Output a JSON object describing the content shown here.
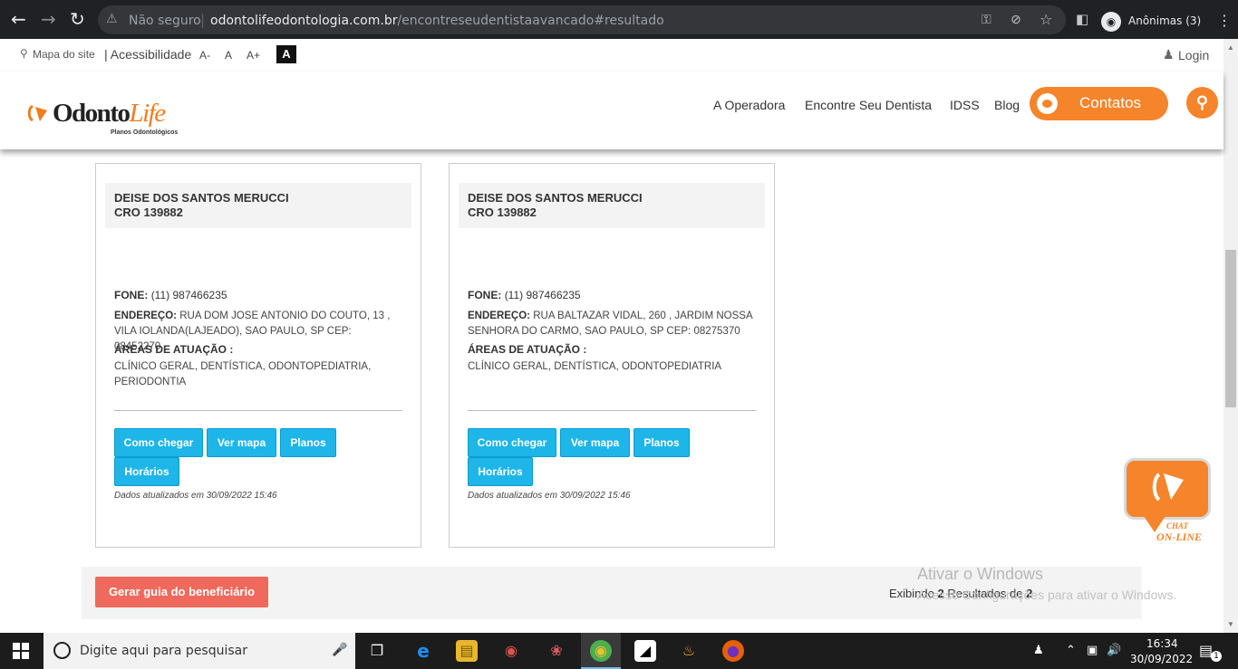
{
  "browser": {
    "security_label": "Não seguro",
    "url_domain": "odontolifeodontologia.com.br",
    "url_path": "/encontreseudentistaavancado#resultado",
    "profile_label": "Anônimas (3)"
  },
  "topbar": {
    "sitemap": "Mapa do site",
    "accessibility": "| Acessibilidade",
    "font_decrease": "A-",
    "font_normal": "A",
    "font_increase": "A+",
    "contrast": "A",
    "login": "Login"
  },
  "header": {
    "logo_word_1": "Odonto",
    "logo_word_2": "Life",
    "logo_sub": "Planos Odontológicos",
    "nav": [
      "A Operadora",
      "Encontre Seu Dentista",
      "IDSS",
      "Blog"
    ],
    "contatos": "Contatos"
  },
  "results": [
    {
      "name": "DEISE DOS SANTOS MERUCCI",
      "cro": "CRO 139882",
      "phone_label": "FONE:",
      "phone": "(11) 987466235",
      "address_label": "ENDEREÇO:",
      "address": "RUA DOM JOSE ANTONIO DO COUTO, 13 , VILA IOLANDA(LAJEADO), SAO PAULO, SP CEP: 08452270",
      "areas_label": "ÁREAS DE ATUAÇÃO :",
      "areas": "CLÍNICO GERAL, DENTÍSTICA, ODONTOPEDIATRIA, PERIODONTIA",
      "buttons": [
        "Como chegar",
        "Ver mapa",
        "Planos",
        "Horários"
      ],
      "updated": "Dados atualizados em 30/09/2022 15:46"
    },
    {
      "name": "DEISE DOS SANTOS MERUCCI",
      "cro": "CRO 139882",
      "phone_label": "FONE:",
      "phone": "(11) 987466235",
      "address_label": "ENDEREÇO:",
      "address": "RUA BALTAZAR VIDAL, 260 , JARDIM NOSSA SENHORA DO CARMO, SAO PAULO, SP CEP: 08275370",
      "areas_label": "ÁREAS DE ATUAÇÃO :",
      "areas": "CLÍNICO GERAL, DENTÍSTICA, ODONTOPEDIATRIA",
      "buttons": [
        "Como chegar",
        "Ver mapa",
        "Planos",
        "Horários"
      ],
      "updated": "Dados atualizados em 30/09/2022 15:46"
    }
  ],
  "footer": {
    "guia_button": "Gerar guia do beneficiário",
    "count_prefix": "Exibindo ",
    "count_shown": "2",
    "count_middle": " Resultados de ",
    "count_total": "2"
  },
  "chat": {
    "line1": "CHAT",
    "line2": "ON-LINE"
  },
  "windows_watermark": {
    "title": "Ativar o Windows",
    "subtitle": "Acesse Configurações para ativar o Windows."
  },
  "taskbar": {
    "search_placeholder": "Digite aqui para pesquisar",
    "time": "16:34",
    "date": "30/09/2022",
    "notifications": "1"
  },
  "colors": {
    "brand_orange": "#f5842a",
    "button_blue": "#1eb6e8",
    "guia_red": "#ef6a5c"
  }
}
